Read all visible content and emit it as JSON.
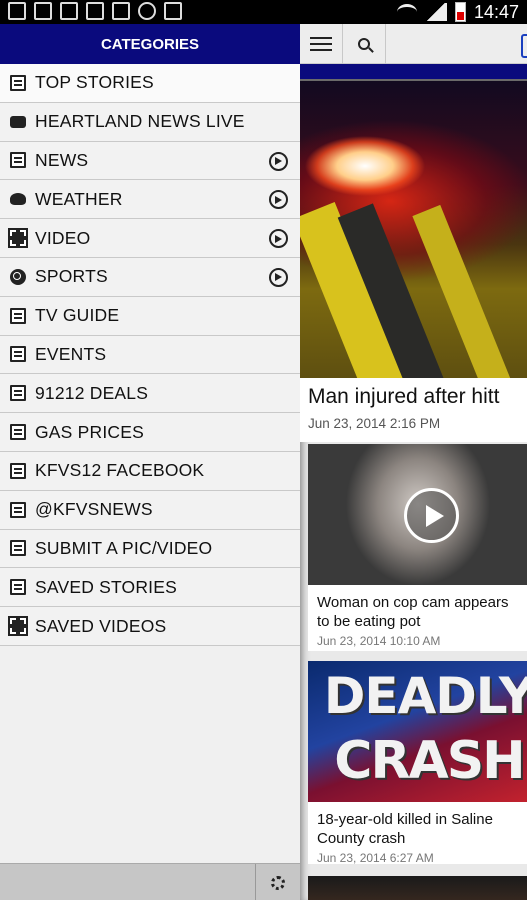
{
  "status_bar": {
    "time": "14:47"
  },
  "drawer": {
    "header": "CATEGORIES",
    "items": [
      {
        "label": "TOP STORIES",
        "icon": "document-icon",
        "has_chevron": false
      },
      {
        "label": "HEARTLAND NEWS LIVE",
        "icon": "video-camera-icon",
        "has_chevron": false
      },
      {
        "label": "NEWS",
        "icon": "document-icon",
        "has_chevron": true
      },
      {
        "label": "WEATHER",
        "icon": "weather-cloud-icon",
        "has_chevron": true
      },
      {
        "label": "VIDEO",
        "icon": "film-icon",
        "has_chevron": true
      },
      {
        "label": "SPORTS",
        "icon": "ball-icon",
        "has_chevron": true
      },
      {
        "label": "TV GUIDE",
        "icon": "document-icon",
        "has_chevron": false
      },
      {
        "label": "EVENTS",
        "icon": "document-icon",
        "has_chevron": false
      },
      {
        "label": "91212 DEALS",
        "icon": "document-icon",
        "has_chevron": false
      },
      {
        "label": "GAS PRICES",
        "icon": "document-icon",
        "has_chevron": false
      },
      {
        "label": "KFVS12 FACEBOOK",
        "icon": "document-icon",
        "has_chevron": false
      },
      {
        "label": "@KFVSNEWS",
        "icon": "document-icon",
        "has_chevron": false
      },
      {
        "label": "SUBMIT A PIC/VIDEO",
        "icon": "document-icon",
        "has_chevron": false
      },
      {
        "label": "SAVED STORIES",
        "icon": "saved-document-icon",
        "has_chevron": false
      },
      {
        "label": "SAVED VIDEOS",
        "icon": "film-icon",
        "has_chevron": false
      }
    ]
  },
  "main": {
    "hero": {
      "title": "Man injured after hitt",
      "date": "Jun 23, 2014 2:16 PM"
    },
    "stories": [
      {
        "caption": "Woman on cop cam appears to be eating pot",
        "date": "Jun 23, 2014 10:10 AM"
      },
      {
        "image_text_line1": "DEADLY",
        "image_text_line2": "CRASH",
        "caption": "18-year-old killed in Saline County crash",
        "date": "Jun 23, 2014 6:27 AM"
      }
    ]
  },
  "colors": {
    "header_blue": "#0a0a7d",
    "drawer_bg": "#f0f0f0",
    "footer_gray": "#c6c6c6"
  }
}
